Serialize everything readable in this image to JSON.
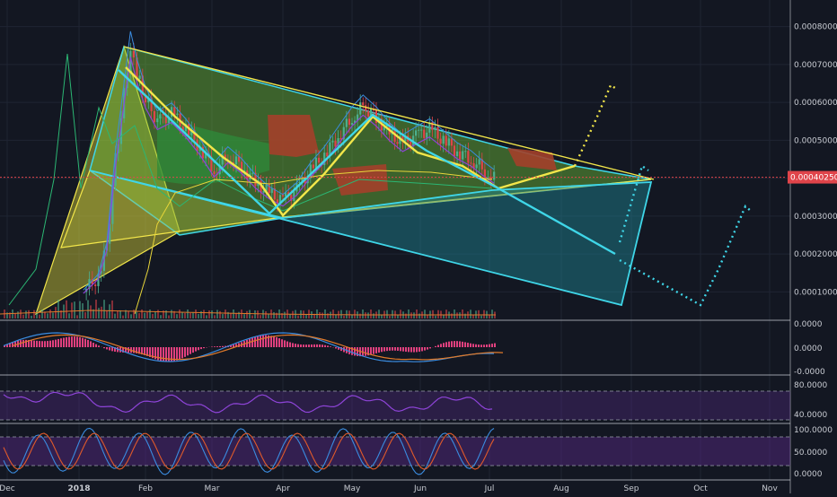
{
  "colors": {
    "background": "#131722",
    "grid": "#1f2433",
    "axis_text": "#c8cbd2",
    "price_line": "#e0444a",
    "price_badge": "#e0444a",
    "candle_up": "#4caf8e",
    "candle_down": "#e0444a",
    "macd_line": "#3a8ce0",
    "signal_line": "#e07a2a",
    "histogram": "#e0407e",
    "rsi_line": "#8e44d8",
    "stoch_k": "#3a8ce0",
    "stoch_d": "#e05a2a",
    "yellow": "#f2e64a",
    "cyan": "#3fd6e8",
    "fill_green": "#6fbf3a",
    "fill_cyan": "#1f8a96",
    "kumo_green": "#2e8b3a",
    "kumo_red": "#a3402a"
  },
  "x_labels": [
    "Dec",
    "2018",
    "Feb",
    "Mar",
    "Apr",
    "May",
    "Jun",
    "Jul",
    "Aug",
    "Sep",
    "Oct",
    "Nov"
  ],
  "price_axis": {
    "ticks": [
      "0.00080000",
      "0.00070000",
      "0.00060000",
      "0.00050000",
      "0.00030000",
      "0.00020000",
      "0.00010000"
    ],
    "current": "0.00040250"
  },
  "macd_axis": {
    "ticks": [
      "0.0000",
      "0.0000",
      "-0.0000"
    ]
  },
  "rsi_axis": {
    "ticks": [
      "80.0000",
      "40.0000"
    ]
  },
  "stoch_axis": {
    "ticks": [
      "100.0000",
      "50.0000",
      "0.0000"
    ]
  },
  "chart_data": {
    "type": "candlestick",
    "symbol_quote_unit": "price",
    "current_price": 0.0004025,
    "ylim": [
      3e-05,
      0.00087
    ],
    "close_series": [
      [
        "2018-01-03",
        0.0001
      ],
      [
        "2018-01-10",
        0.00014
      ],
      [
        "2018-01-14",
        0.00022
      ],
      [
        "2018-01-18",
        0.00045
      ],
      [
        "2018-01-22",
        0.00062
      ],
      [
        "2018-01-25",
        0.00075
      ],
      [
        "2018-01-28",
        0.00068
      ],
      [
        "2018-02-01",
        0.00061
      ],
      [
        "2018-02-06",
        0.00055
      ],
      [
        "2018-02-12",
        0.00057
      ],
      [
        "2018-02-18",
        0.00053
      ],
      [
        "2018-02-24",
        0.00048
      ],
      [
        "2018-03-02",
        0.00042
      ],
      [
        "2018-03-08",
        0.00046
      ],
      [
        "2018-03-14",
        0.00043
      ],
      [
        "2018-03-20",
        0.00039
      ],
      [
        "2018-03-26",
        0.00036
      ],
      [
        "2018-04-01",
        0.00034
      ],
      [
        "2018-04-07",
        0.00037
      ],
      [
        "2018-04-13",
        0.00042
      ],
      [
        "2018-04-19",
        0.00046
      ],
      [
        "2018-04-25",
        0.00051
      ],
      [
        "2018-05-01",
        0.00056
      ],
      [
        "2018-05-06",
        0.00059
      ],
      [
        "2018-05-12",
        0.00056
      ],
      [
        "2018-05-18",
        0.00052
      ],
      [
        "2018-05-24",
        0.00049
      ],
      [
        "2018-05-30",
        0.00051
      ],
      [
        "2018-06-05",
        0.00053
      ],
      [
        "2018-06-11",
        0.0005
      ],
      [
        "2018-06-17",
        0.00047
      ],
      [
        "2018-06-23",
        0.00045
      ],
      [
        "2018-06-29",
        0.00042
      ],
      [
        "2018-07-03",
        0.0004025
      ]
    ]
  }
}
